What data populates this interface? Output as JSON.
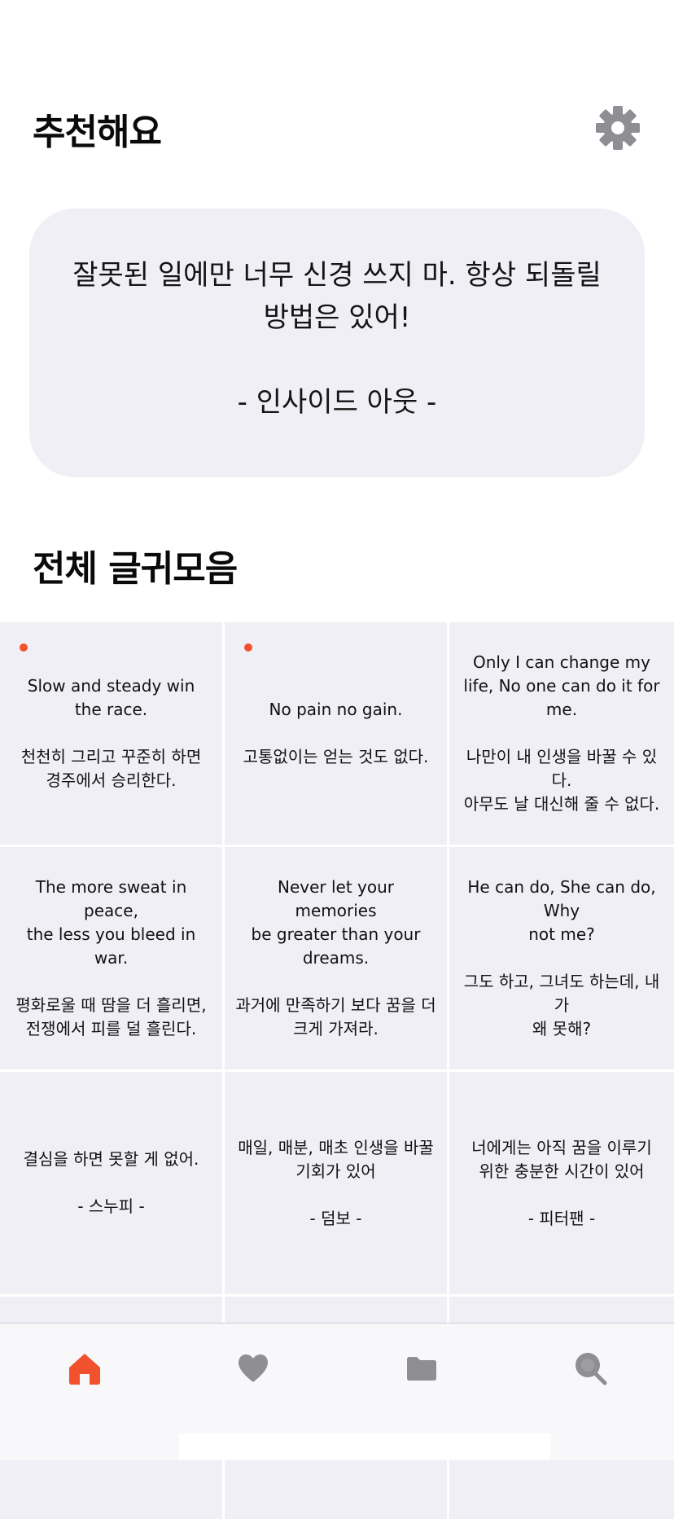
{
  "header": {
    "title": "추천해요",
    "settings_icon": "gear-icon"
  },
  "featured": {
    "quote": "잘못된 일에만 너무 신경 쓰지 마. 항상 되돌릴 방법은 있어!",
    "source": "- 인사이드 아웃 -"
  },
  "all_section": {
    "title": "전체 글귀모음"
  },
  "quotes": [
    {
      "en": "Slow and steady win\nthe race.",
      "ko": "천천히 그리고 꾸준히 하면\n경주에서 승리한다.",
      "new": true
    },
    {
      "en": "No pain no gain.",
      "ko": "고통없이는 얻는 것도 없다.",
      "new": true
    },
    {
      "en": "Only I can change my\nlife, No one can do it for\nme.",
      "ko": "나만이 내 인생을 바꿀 수 있다.\n아무도 날 대신해 줄 수 없다.",
      "new": false
    },
    {
      "en": "The more sweat in peace,\nthe less you bleed in war.",
      "ko": "평화로울 때 땀을 더 흘리면,\n전쟁에서 피를 덜 흘린다.",
      "new": false
    },
    {
      "en": "Never let your memories\nbe greater than your\ndreams.",
      "ko": "과거에 만족하기 보다 꿈을 더\n크게 가져라.",
      "new": false
    },
    {
      "en": "He can do, She can do, Why\nnot me?",
      "ko": "그도 하고, 그녀도 하는데, 내가\n왜 못해?",
      "new": false
    },
    {
      "en": "결심을 하면 못할 게 없어.",
      "ko": "- 스누피 -",
      "new": false
    },
    {
      "en": "매일, 매분, 매초 인생을 바꿀\n기회가 있어",
      "ko": "- 덤보 -",
      "new": false
    },
    {
      "en": "너에게는 아직 꿈을 이루기\n위한 충분한 시간이 있어",
      "ko": "- 피터팬 -",
      "new": false
    },
    {
      "en": "",
      "ko": "",
      "new": false
    },
    {
      "en": "",
      "ko": "",
      "new": false
    },
    {
      "en": "",
      "ko": "",
      "new": false
    }
  ],
  "tabbar": {
    "items": [
      {
        "icon": "home-icon",
        "active": true
      },
      {
        "icon": "heart-icon",
        "active": false
      },
      {
        "icon": "folder-icon",
        "active": false
      },
      {
        "icon": "search-icon",
        "active": false
      }
    ]
  },
  "colors": {
    "accent": "#f0522e",
    "card_bg": "#f0eff5",
    "icon_gray": "#8e8e93"
  }
}
